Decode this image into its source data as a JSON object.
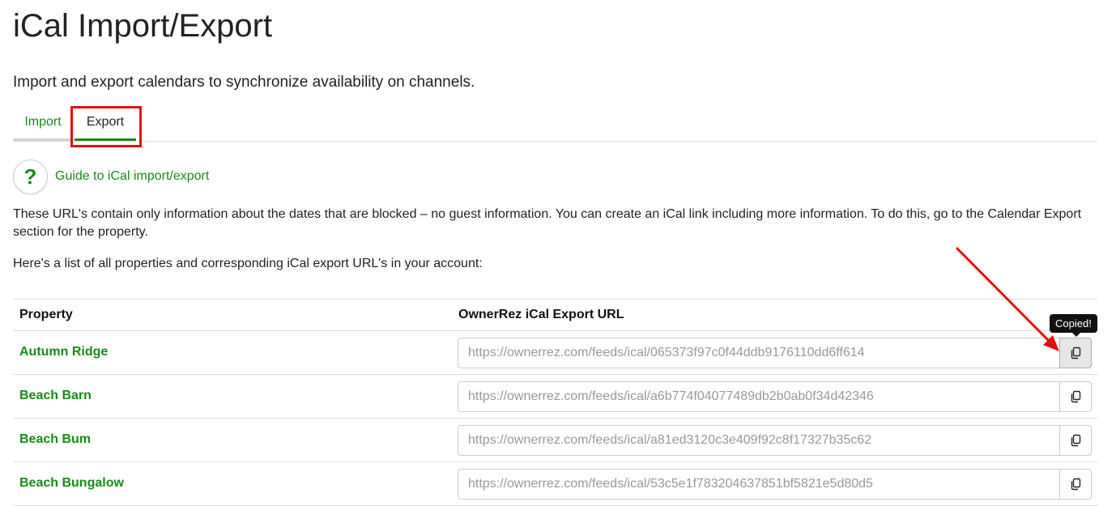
{
  "page": {
    "title": "iCal Import/Export",
    "subtitle": "Import and export calendars to synchronize availability on channels."
  },
  "tabs": [
    {
      "label": "Import",
      "active": false
    },
    {
      "label": "Export",
      "active": true
    }
  ],
  "guide": {
    "icon": "question-mark-icon",
    "icon_glyph": "?",
    "link": "Guide to iCal import/export"
  },
  "info": {
    "paragraph1": "These URL's contain only information about the dates that are blocked – no guest information. You can create an iCal link including more information. To do this, go to the Calendar Export section for the property.",
    "paragraph2": "Here's a list of all properties and corresponding iCal export URL's in your account:"
  },
  "table": {
    "headers": {
      "property": "Property",
      "url": "OwnerRez iCal Export URL"
    },
    "rows": [
      {
        "property": "Autumn Ridge",
        "url": "https://ownerrez.com/feeds/ical/065373f97c0f44ddb9176110dd6ff614"
      },
      {
        "property": "Beach Barn",
        "url": "https://ownerrez.com/feeds/ical/a6b774f04077489db2b0ab0f34d42346"
      },
      {
        "property": "Beach Bum",
        "url": "https://ownerrez.com/feeds/ical/a81ed3120c3e409f92c8f17327b35c62"
      },
      {
        "property": "Beach Bungalow",
        "url": "https://ownerrez.com/feeds/ical/53c5e1f783204637851bf5821e5d80d5"
      }
    ]
  },
  "tooltip": {
    "text": "Copied!"
  },
  "colors": {
    "accent_green": "#1a8a1a",
    "annotation_red": "#e01010"
  }
}
